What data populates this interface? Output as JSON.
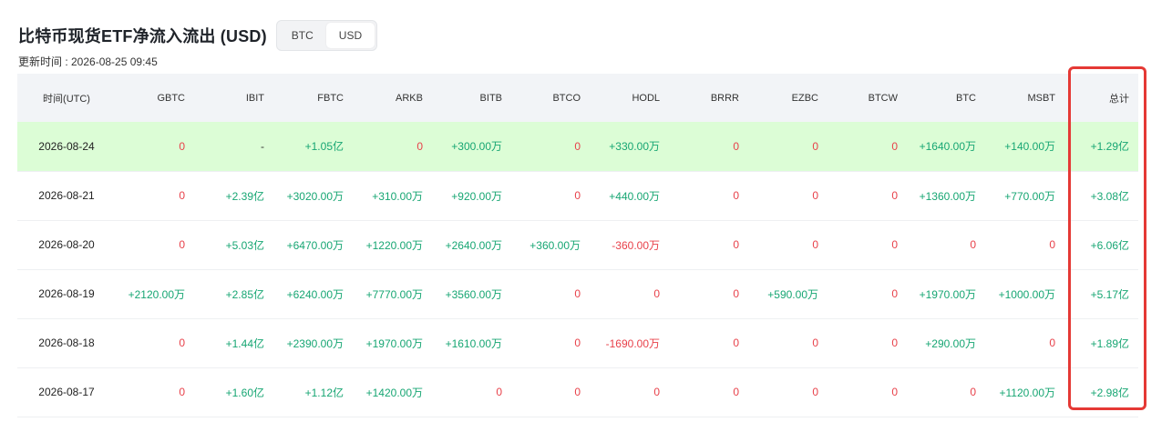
{
  "header": {
    "title": "比特币现货ETF净流入流出 (USD)",
    "toggle": [
      "BTC",
      "USD"
    ],
    "active_toggle": "USD",
    "updated": "更新时间 : 2026-08-25 09:45"
  },
  "table": {
    "columns": [
      "时间(UTC)",
      "GBTC",
      "IBIT",
      "FBTC",
      "ARKB",
      "BITB",
      "BTCO",
      "HODL",
      "BRRR",
      "EZBC",
      "BTCW",
      "BTC",
      "MSBT",
      "总计"
    ],
    "rows": [
      [
        "2026-08-24",
        "0",
        "-",
        "+1.05亿",
        "0",
        "+300.00万",
        "0",
        "+330.00万",
        "0",
        "0",
        "0",
        "+1640.00万",
        "+140.00万",
        "+1.29亿"
      ],
      [
        "2026-08-21",
        "0",
        "+2.39亿",
        "+3020.00万",
        "+310.00万",
        "+920.00万",
        "0",
        "+440.00万",
        "0",
        "0",
        "0",
        "+1360.00万",
        "+770.00万",
        "+3.08亿"
      ],
      [
        "2026-08-20",
        "0",
        "+5.03亿",
        "+6470.00万",
        "+1220.00万",
        "+2640.00万",
        "+360.00万",
        "-360.00万",
        "0",
        "0",
        "0",
        "0",
        "0",
        "+6.06亿"
      ],
      [
        "2026-08-19",
        "+2120.00万",
        "+2.85亿",
        "+6240.00万",
        "+7770.00万",
        "+3560.00万",
        "0",
        "0",
        "0",
        "+590.00万",
        "0",
        "+1970.00万",
        "+1000.00万",
        "+5.17亿"
      ],
      [
        "2026-08-18",
        "0",
        "+1.44亿",
        "+2390.00万",
        "+1970.00万",
        "+1610.00万",
        "0",
        "-1690.00万",
        "0",
        "0",
        "0",
        "+290.00万",
        "0",
        "+1.89亿"
      ],
      [
        "2026-08-17",
        "0",
        "+1.60亿",
        "+1.12亿",
        "+1420.00万",
        "0",
        "0",
        "0",
        "0",
        "0",
        "0",
        "0",
        "+1120.00万",
        "+2.98亿"
      ]
    ]
  },
  "colors": {
    "positive": "#17a673",
    "negative": "#e8414a",
    "highlight_row": "#dcfdd6",
    "outline": "#e53935"
  }
}
